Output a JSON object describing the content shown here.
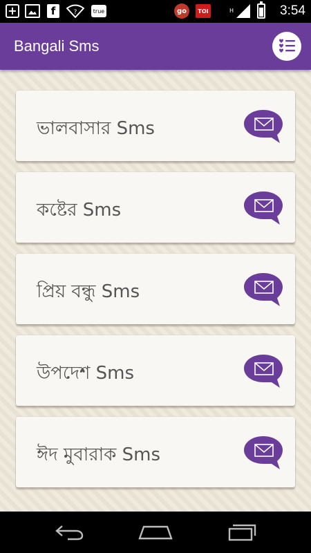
{
  "status_bar": {
    "time": "3:54",
    "fb_letter": "f",
    "true_label": "true",
    "go_label": "go",
    "toi_label": "TOI",
    "plus_symbol": "+"
  },
  "app_bar": {
    "title": "Bangali Sms",
    "menu_icon": "favorites-list-icon"
  },
  "categories": [
    {
      "label": "ভালবাসার Sms"
    },
    {
      "label": "কষ্টের Sms"
    },
    {
      "label": "প্রিয় বন্ধু Sms"
    },
    {
      "label": "উপদেশ Sms"
    },
    {
      "label": "ঈদ মুবারাক Sms"
    }
  ],
  "colors": {
    "accent": "#6a3d9a",
    "background": "#ede6d8",
    "card": "#f9f7f3",
    "text": "#555555"
  },
  "nav_bar": {
    "back_icon": "back-icon",
    "home_icon": "home-icon",
    "recents_icon": "recents-icon"
  }
}
